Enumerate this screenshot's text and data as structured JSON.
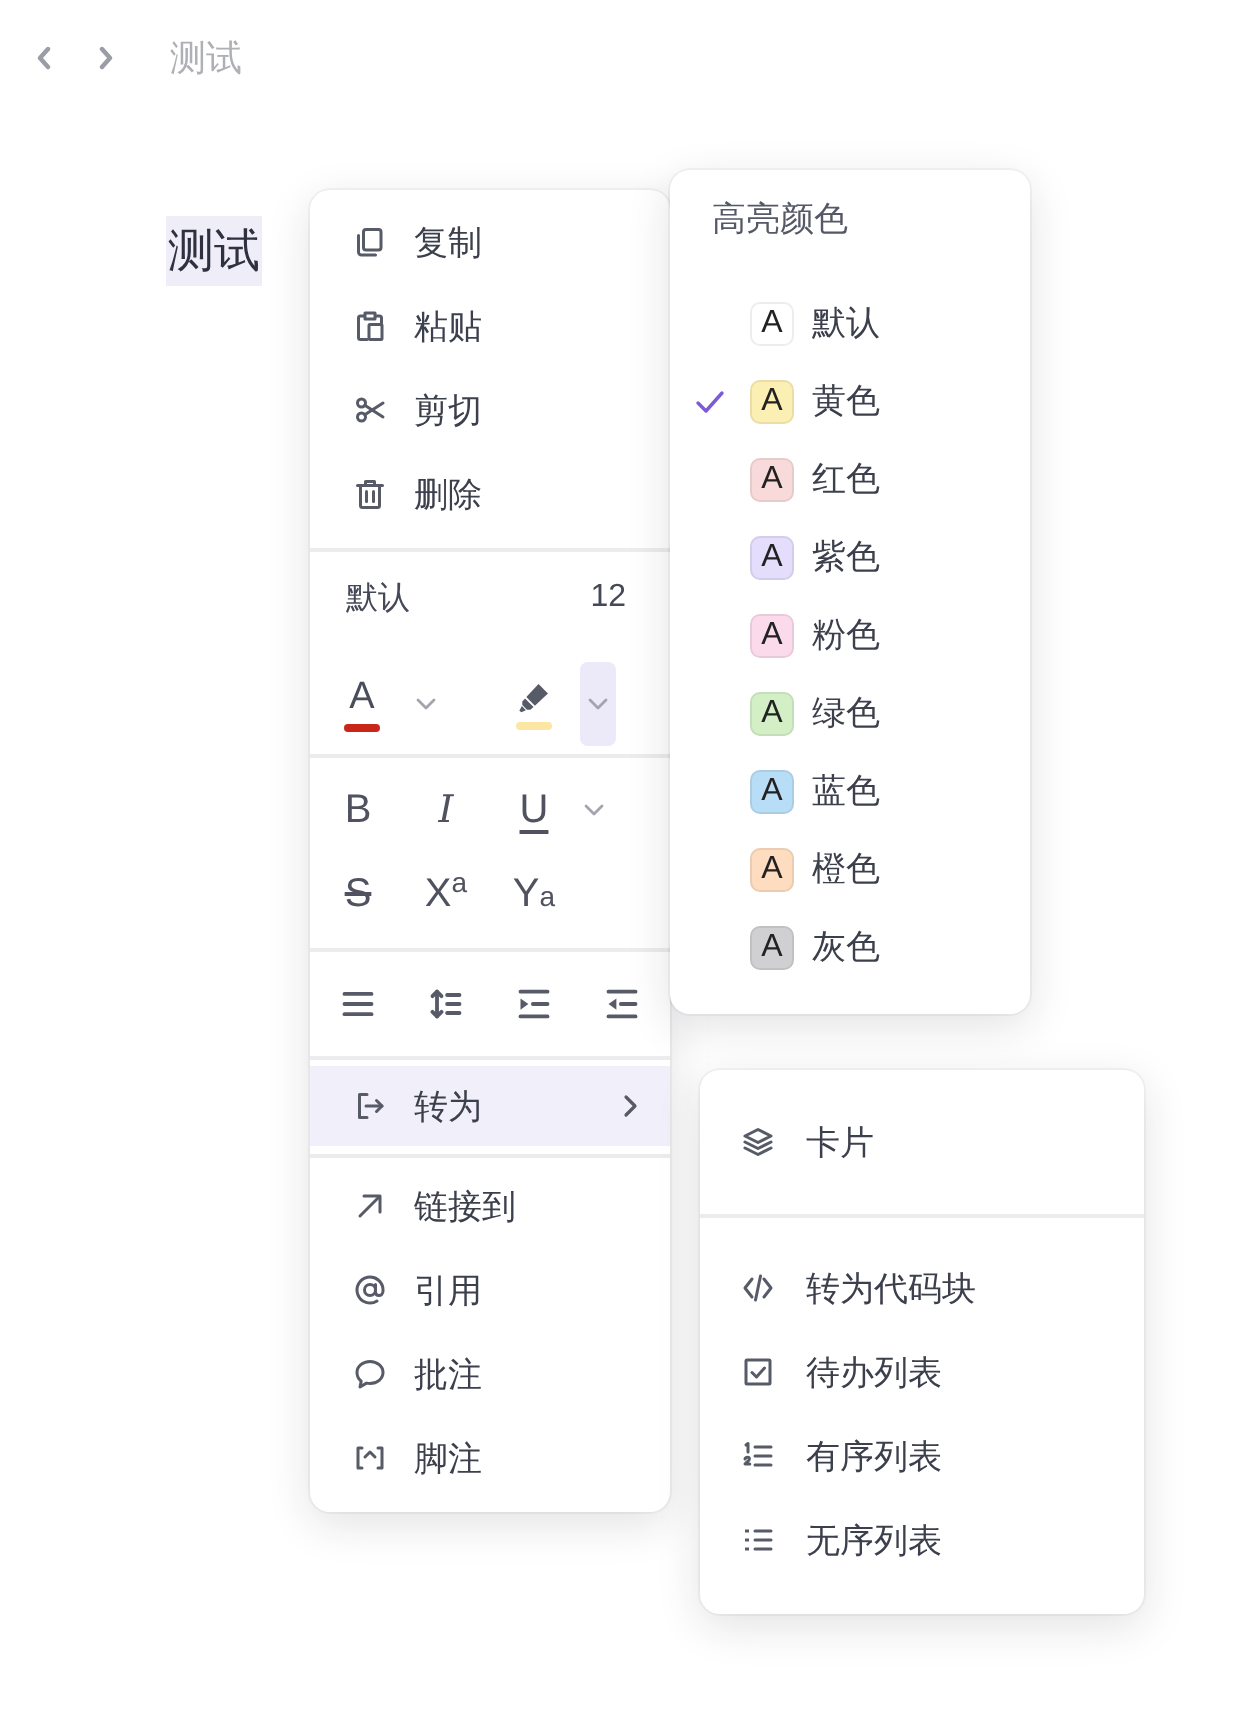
{
  "nav": {
    "title": "测试"
  },
  "document": {
    "text": "测试",
    "selected": true
  },
  "context_menu": {
    "clipboard": [
      {
        "label": "复制"
      },
      {
        "label": "粘贴"
      },
      {
        "label": "剪切"
      },
      {
        "label": "删除"
      }
    ],
    "font": {
      "family": "默认",
      "size": "12"
    },
    "color_buttons": [
      {
        "kind": "text_color",
        "label": "A",
        "color": "#c9261a",
        "open": false
      },
      {
        "kind": "highlight",
        "color": "#fbe7a1",
        "open": true
      }
    ],
    "format_rows": [
      [
        {
          "kind": "bold",
          "label": "B",
          "dropdown": false
        },
        {
          "kind": "italic",
          "label": "I",
          "dropdown": false
        },
        {
          "kind": "underline",
          "label": "U",
          "dropdown": true
        }
      ],
      [
        {
          "kind": "strikethrough",
          "label": "S",
          "dropdown": false
        },
        {
          "kind": "superscript",
          "label": "X$^{a}$",
          "dropdown": false
        },
        {
          "kind": "subscript",
          "label": "Y$_{a}$",
          "dropdown": false
        }
      ]
    ],
    "convert": {
      "label": "转为",
      "highlighted": true
    },
    "insert": [
      {
        "label": "链接到"
      },
      {
        "label": "引用"
      },
      {
        "label": "批注"
      },
      {
        "label": "脚注"
      }
    ]
  },
  "highlight_panel": {
    "title": "高亮颜色",
    "options": [
      {
        "sample": "A",
        "label": "默认",
        "color": "#ffffff",
        "selected": false
      },
      {
        "sample": "A",
        "label": "黄色",
        "color": "#fcefb3",
        "selected": true
      },
      {
        "sample": "A",
        "label": "红色",
        "color": "#f9dada",
        "selected": false
      },
      {
        "sample": "A",
        "label": "紫色",
        "color": "#e4ddfb",
        "selected": false
      },
      {
        "sample": "A",
        "label": "粉色",
        "color": "#fbdaeb",
        "selected": false
      },
      {
        "sample": "A",
        "label": "绿色",
        "color": "#d3efc5",
        "selected": false
      },
      {
        "sample": "A",
        "label": "蓝色",
        "color": "#b8ddf6",
        "selected": false
      },
      {
        "sample": "A",
        "label": "橙色",
        "color": "#fddcbf",
        "selected": false
      },
      {
        "sample": "A",
        "label": "灰色",
        "color": "#d0d0d2",
        "selected": false
      }
    ]
  },
  "convert_submenu": {
    "groups": [
      [
        {
          "label": "卡片"
        }
      ],
      [
        {
          "label": "转为代码块"
        },
        {
          "label": "待办列表"
        },
        {
          "label": "有序列表"
        },
        {
          "label": "无序列表"
        }
      ]
    ]
  }
}
